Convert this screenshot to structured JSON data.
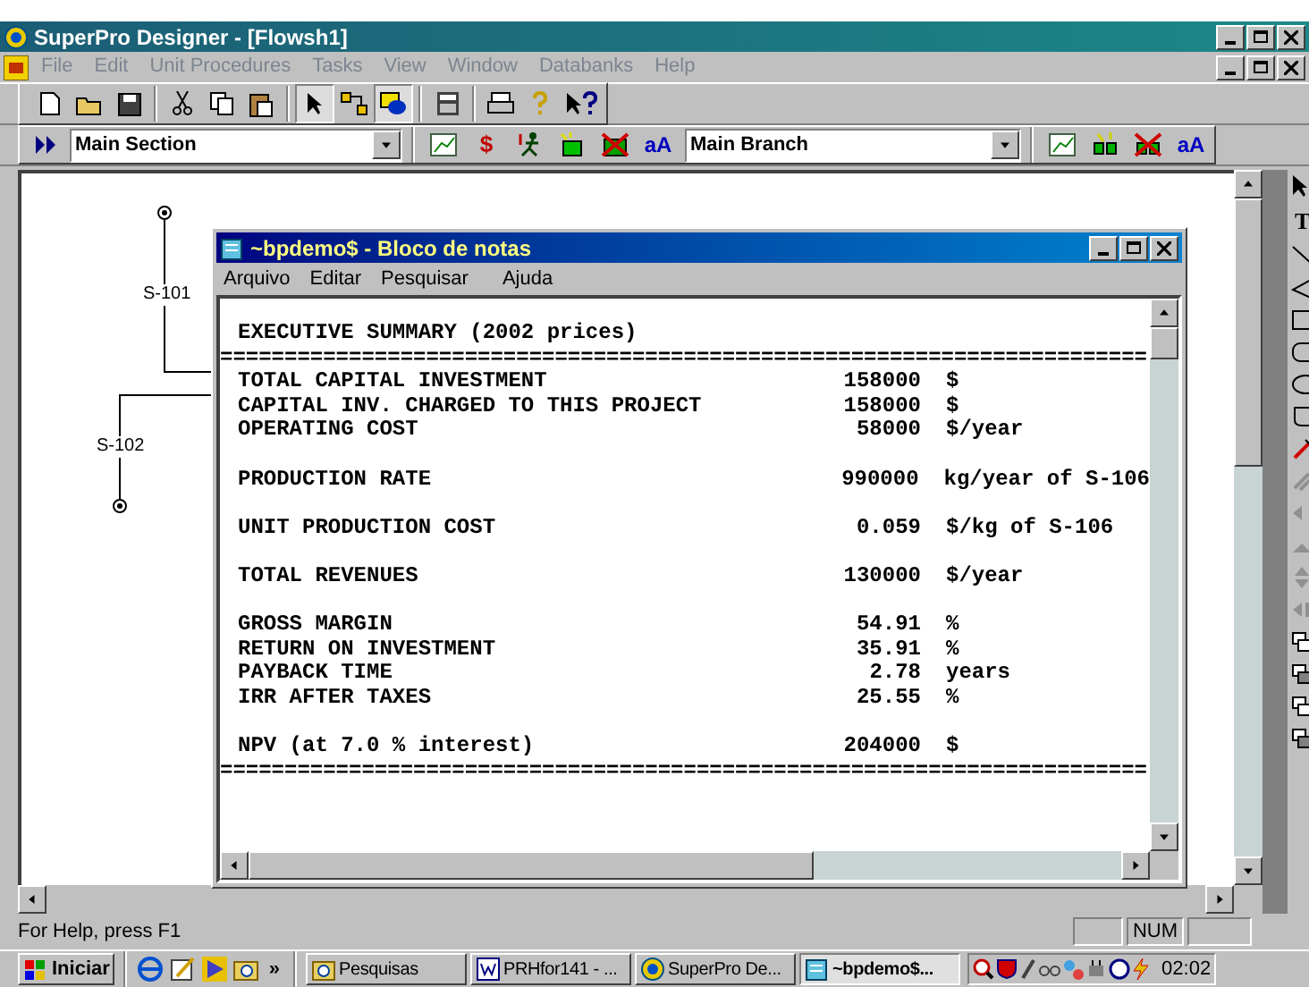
{
  "app_window": {
    "title": "SuperPro Designer - [Flowsh1]"
  },
  "menu": [
    {
      "label": "File",
      "disabled": true
    },
    {
      "label": "Edit",
      "disabled": true
    },
    {
      "label": "Unit Procedures",
      "disabled": true
    },
    {
      "label": "Tasks",
      "disabled": true
    },
    {
      "label": "View",
      "disabled": true
    },
    {
      "label": "Window",
      "disabled": true
    },
    {
      "label": "Databanks",
      "disabled": true
    },
    {
      "label": "Help",
      "disabled": true
    }
  ],
  "toolbar": {
    "tools": [
      {
        "selected": true
      },
      {
        "selected": false
      },
      {
        "selected": true
      }
    ]
  },
  "section_bar": {
    "section": "Main Section",
    "dollar_label": "$",
    "font_label": "aA",
    "branch": "Main Branch",
    "branch_font_label": "aA"
  },
  "flowsheet": {
    "streams": [
      {
        "label": "S-101"
      },
      {
        "label": "S-102"
      }
    ]
  },
  "notepad": {
    "title": "~bpdemo$ - Bloco de notas",
    "menu": [
      "Arquivo",
      "Editar",
      "Pesquisar",
      "Ajuda"
    ],
    "heading": "EXECUTIVE SUMMARY (2002 prices)",
    "rule": "========================================================================",
    "groups": [
      [
        {
          "label": "TOTAL CAPITAL INVESTMENT",
          "value": "158000",
          "unit": "$"
        },
        {
          "label": "CAPITAL INV. CHARGED TO THIS PROJECT",
          "value": "158000",
          "unit": "$"
        },
        {
          "label": "OPERATING COST",
          "value": "58000",
          "unit": "$/year"
        }
      ],
      [
        {
          "label": "PRODUCTION RATE",
          "value": "990000",
          "unit": "kg/year of S-106"
        }
      ],
      [
        {
          "label": "UNIT PRODUCTION COST",
          "value": "0.059",
          "unit": "$/kg of S-106"
        }
      ],
      [
        {
          "label": "TOTAL REVENUES",
          "value": "130000",
          "unit": "$/year"
        }
      ],
      [
        {
          "label": "GROSS MARGIN",
          "value": "54.91",
          "unit": "%"
        },
        {
          "label": "RETURN ON INVESTMENT",
          "value": "35.91",
          "unit": "%"
        },
        {
          "label": "PAYBACK TIME",
          "value": "2.78",
          "unit": "years"
        },
        {
          "label": "IRR AFTER TAXES",
          "value": "25.55",
          "unit": "%"
        }
      ],
      [
        {
          "label": "NPV (at 7.0 % interest)",
          "value": "204000",
          "unit": "$"
        }
      ]
    ],
    "end_rule": "========================================================================"
  },
  "drawing_toolbar": {
    "text_tool": "T"
  },
  "status_bar": {
    "message": "For Help, press F1",
    "indicator": "NUM"
  },
  "taskbar": {
    "start": "Iniciar",
    "more": "»",
    "tasks": [
      {
        "label": "Pesquisas",
        "selected": false
      },
      {
        "label": "PRHfor141 - ...",
        "selected": false
      },
      {
        "label": "SuperPro De...",
        "selected": false
      },
      {
        "label": "~bpdemo$...",
        "selected": true
      }
    ],
    "clock": "02:02"
  }
}
